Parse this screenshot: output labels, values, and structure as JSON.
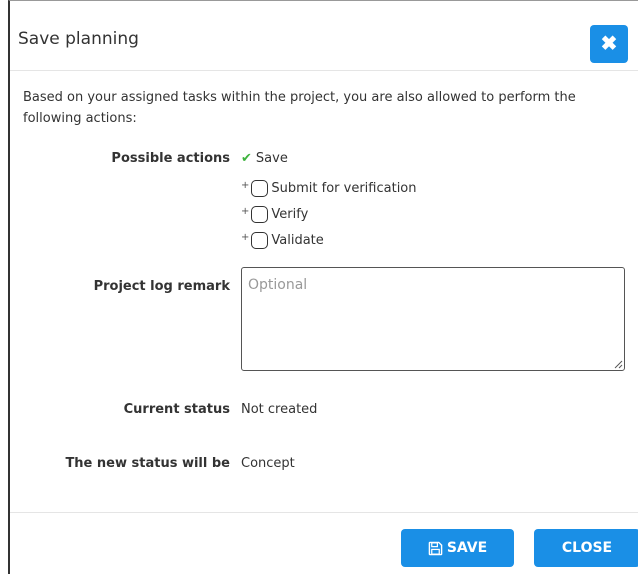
{
  "dialog": {
    "title": "Save planning",
    "close_icon_label": "✖"
  },
  "intro_text": "Based on your assigned tasks within the project, you are also allowed to perform the following actions:",
  "possible_actions": {
    "label": "Possible actions",
    "default_action": "Save",
    "plus_marker": "+",
    "options": [
      {
        "label": "Submit for verification",
        "checked": false
      },
      {
        "label": "Verify",
        "checked": false
      },
      {
        "label": "Validate",
        "checked": false
      }
    ]
  },
  "project_log_remark": {
    "label": "Project log remark",
    "placeholder": "Optional",
    "value": ""
  },
  "current_status": {
    "label": "Current status",
    "value": "Not created"
  },
  "new_status": {
    "label": "The new status will be",
    "value": "Concept"
  },
  "footer": {
    "save_label": "SAVE",
    "close_label": "CLOSE"
  },
  "colors": {
    "accent": "#1a8fe6",
    "check": "#3db33d"
  }
}
